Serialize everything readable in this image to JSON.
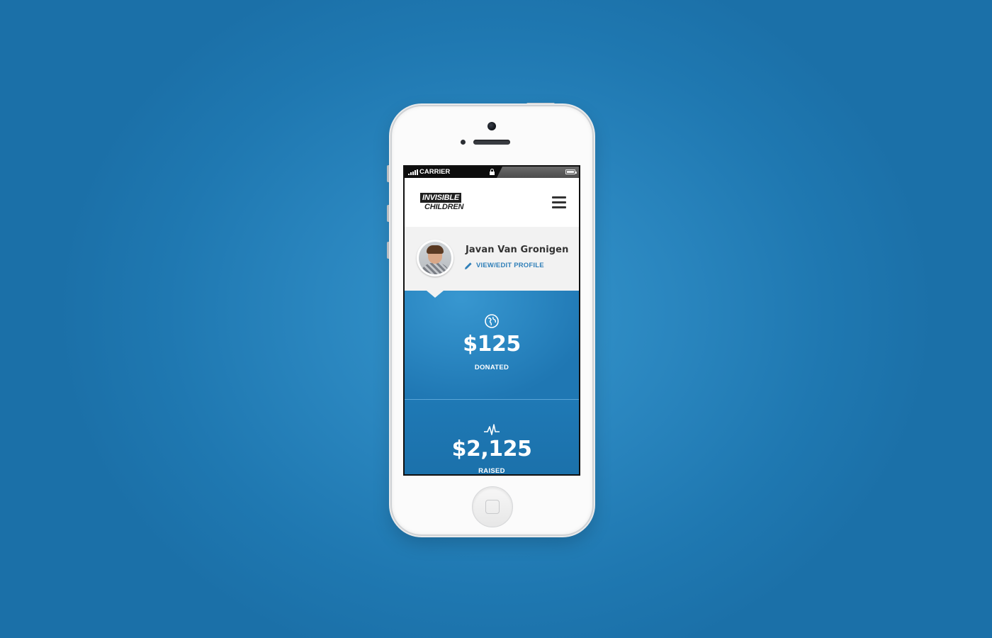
{
  "status_bar": {
    "carrier": "CARRIER"
  },
  "header": {
    "logo_line1": "INVISIBLE",
    "logo_line2": "CHILDREN"
  },
  "profile": {
    "name": "Javan Van Gronigen",
    "edit_label": "VIEW/EDIT PROFILE"
  },
  "stats": [
    {
      "value": "$125",
      "label": "DONATED",
      "icon": "globe-icon"
    },
    {
      "value": "$2,125",
      "label": "RAISED",
      "icon": "pulse-icon"
    }
  ],
  "colors": {
    "background": "#2a86bf",
    "accent": "#2f7fb8",
    "stat_panel": "#2a86c1"
  }
}
